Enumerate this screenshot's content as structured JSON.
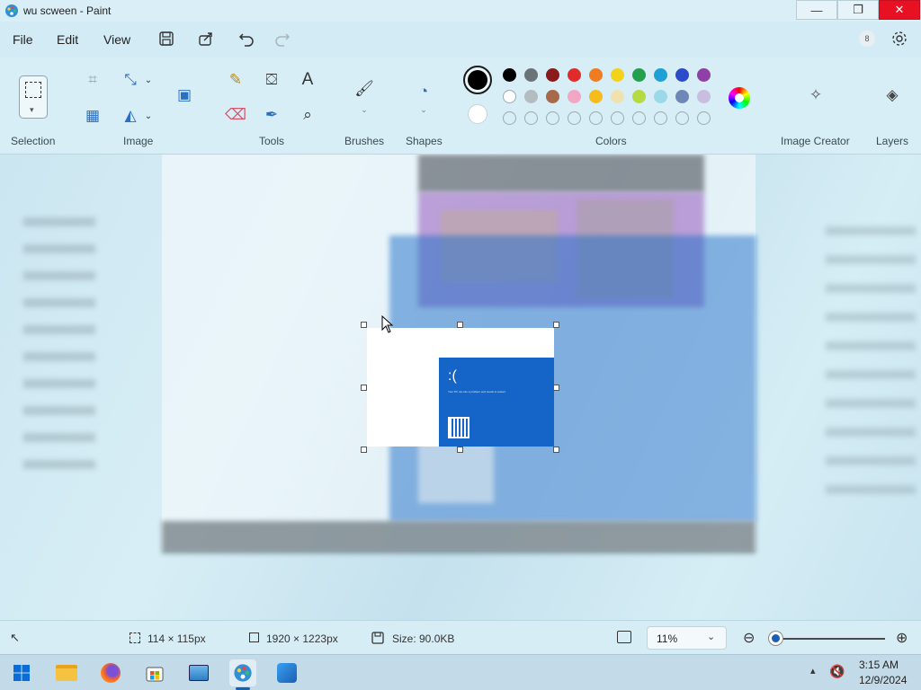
{
  "window": {
    "title": "wu scween - Paint",
    "minimize": "—",
    "maximize": "❐",
    "close": "✕"
  },
  "menu": {
    "file": "File",
    "edit": "Edit",
    "view": "View"
  },
  "ribbon": {
    "groups": {
      "selection": "Selection",
      "image": "Image",
      "tools": "Tools",
      "brushes": "Brushes",
      "shapes": "Shapes",
      "colors": "Colors",
      "image_creator": "Image Creator",
      "layers": "Layers"
    },
    "text_tool": "A",
    "primary_color": "#000000",
    "secondary_color": "#ffffff",
    "palette_row1": [
      "#000000",
      "#6b7378",
      "#8b1a1a",
      "#e02b2b",
      "#f07c22",
      "#f3d21c",
      "#22a04b",
      "#1e9fd6",
      "#2b4cc8",
      "#8f3fa6"
    ],
    "palette_row2": [
      "#ffffff",
      "#b4bcc0",
      "#a8694a",
      "#f3a5c4",
      "#f5bc1c",
      "#f0e2b0",
      "#b5d940",
      "#9ad9e8",
      "#6f86b8",
      "#c9bde0"
    ]
  },
  "canvas": {
    "bsod_face": ":(",
    "bsod_note": "Your PC ran into a problem and needs to restart."
  },
  "status": {
    "selection_size": "114 × 115px",
    "canvas_size": "1920 × 1223px",
    "file_size": "Size: 90.0KB",
    "zoom": "11%",
    "zoom_level": 0.11
  },
  "taskbar": {
    "time": "3:15 AM",
    "date": "12/9/2024"
  }
}
